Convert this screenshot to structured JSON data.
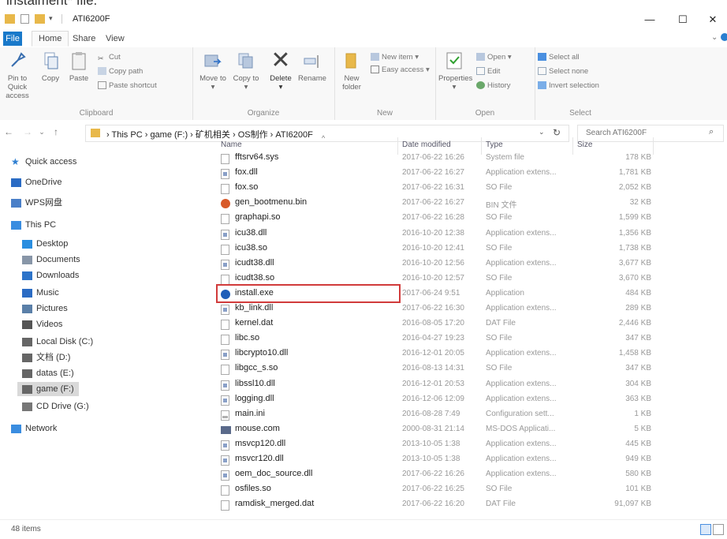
{
  "caption": "instalment* file.",
  "window": {
    "title": "ATI6200F",
    "minimize": "—",
    "maximize": "☐",
    "close": "✕"
  },
  "tabs": [
    "File",
    "Home",
    "Share",
    "View"
  ],
  "ribbon": {
    "clipboard": {
      "label": "Clipboard",
      "pin": "Pin to Quick access",
      "copy": "Copy",
      "paste": "Paste",
      "cut": "Cut",
      "copy_path": "Copy path",
      "paste_shortcut": "Paste shortcut"
    },
    "organize": {
      "label": "Organize",
      "move_to": "Move to",
      "copy_to": "Copy to",
      "delete": "Delete",
      "rename": "Rename"
    },
    "new": {
      "label": "New",
      "new_folder": "New folder",
      "new_item": "New item",
      "easy_access": "Easy access"
    },
    "open": {
      "label": "Open",
      "properties": "Properties",
      "open": "Open",
      "edit": "Edit",
      "history": "History"
    },
    "select": {
      "label": "Select",
      "select_all": "Select all",
      "select_none": "Select none",
      "invert": "Invert selection"
    }
  },
  "address": {
    "crumbs": [
      "This PC",
      "game (F:)",
      "矿机相关",
      "OS制作",
      "ATI6200F"
    ],
    "search_placeholder": "Search ATI6200F"
  },
  "nav": [
    {
      "label": "Quick access",
      "icon": "star-icon",
      "color": "#2f7fd1"
    },
    {
      "label": "OneDrive",
      "icon": "cloud-icon",
      "color": "#2b6cc4"
    },
    {
      "label": "WPS网盘",
      "icon": "cloud-outline-icon",
      "color": "#4a7fc8"
    },
    {
      "label": "This PC",
      "icon": "computer-icon",
      "color": "#3a8de0"
    },
    {
      "label": "Desktop",
      "icon": "desktop-icon",
      "color": "#2a8ee0"
    },
    {
      "label": "Documents",
      "icon": "documents-icon",
      "color": "#8896a8"
    },
    {
      "label": "Downloads",
      "icon": "download-icon",
      "color": "#2d74c9"
    },
    {
      "label": "Music",
      "icon": "music-icon",
      "color": "#2b6cc4"
    },
    {
      "label": "Pictures",
      "icon": "pictures-icon",
      "color": "#5a7fa8"
    },
    {
      "label": "Videos",
      "icon": "video-icon",
      "color": "#555"
    },
    {
      "label": "Local Disk (C:)",
      "icon": "drive-icon",
      "color": "#666"
    },
    {
      "label": "文档 (D:)",
      "icon": "drive-icon",
      "color": "#666"
    },
    {
      "label": "datas (E:)",
      "icon": "drive-icon",
      "color": "#666"
    },
    {
      "label": "game (F:)",
      "icon": "drive-icon",
      "color": "#666"
    },
    {
      "label": "CD Drive (G:)",
      "icon": "cd-drive-icon",
      "color": "#777"
    },
    {
      "label": "Network",
      "icon": "network-icon",
      "color": "#3a8de0"
    }
  ],
  "columns": {
    "name": "Name",
    "date": "Date modified",
    "type": "Type",
    "size": "Size"
  },
  "files": [
    {
      "name": "fftsrv64.sys",
      "date": "2017-06-22 16:26",
      "type": "System file",
      "size": "178 KB",
      "kind": "file"
    },
    {
      "name": "fox.dll",
      "date": "2017-06-22 16:27",
      "type": "Application extens...",
      "size": "1,781 KB",
      "kind": "dll"
    },
    {
      "name": "fox.so",
      "date": "2017-06-22 16:31",
      "type": "SO File",
      "size": "2,052 KB",
      "kind": "file"
    },
    {
      "name": "gen_bootmenu.bin",
      "date": "2017-06-22 16:27",
      "type": "BIN 文件",
      "size": "32 KB",
      "kind": "bin"
    },
    {
      "name": "graphapi.so",
      "date": "2017-06-22 16:28",
      "type": "SO File",
      "size": "1,599 KB",
      "kind": "file"
    },
    {
      "name": "icu38.dll",
      "date": "2016-10-20 12:38",
      "type": "Application extens...",
      "size": "1,356 KB",
      "kind": "dll"
    },
    {
      "name": "icu38.so",
      "date": "2016-10-20 12:41",
      "type": "SO File",
      "size": "1,738 KB",
      "kind": "file"
    },
    {
      "name": "icudt38.dll",
      "date": "2016-10-20 12:56",
      "type": "Application extens...",
      "size": "3,677 KB",
      "kind": "dll"
    },
    {
      "name": "icudt38.so",
      "date": "2016-10-20 12:57",
      "type": "SO File",
      "size": "3,670 KB",
      "kind": "file"
    },
    {
      "name": "install.exe",
      "date": "2017-06-24 9:51",
      "type": "Application",
      "size": "484 KB",
      "kind": "app"
    },
    {
      "name": "kb_link.dll",
      "date": "2017-06-22 16:30",
      "type": "Application extens...",
      "size": "289 KB",
      "kind": "dll"
    },
    {
      "name": "kernel.dat",
      "date": "2016-08-05 17:20",
      "type": "DAT File",
      "size": "2,446 KB",
      "kind": "file"
    },
    {
      "name": "libc.so",
      "date": "2016-04-27 19:23",
      "type": "SO File",
      "size": "347 KB",
      "kind": "file"
    },
    {
      "name": "libcrypto10.dll",
      "date": "2016-12-01 20:05",
      "type": "Application extens...",
      "size": "1,458 KB",
      "kind": "dll"
    },
    {
      "name": "libgcc_s.so",
      "date": "2016-08-13 14:31",
      "type": "SO File",
      "size": "347 KB",
      "kind": "file"
    },
    {
      "name": "libssl10.dll",
      "date": "2016-12-01 20:53",
      "type": "Application extens...",
      "size": "304 KB",
      "kind": "dll"
    },
    {
      "name": "logging.dll",
      "date": "2016-12-06 12:09",
      "type": "Application extens...",
      "size": "363 KB",
      "kind": "dll"
    },
    {
      "name": "main.ini",
      "date": "2016-08-28 7:49",
      "type": "Configuration sett...",
      "size": "1 KB",
      "kind": "ini"
    },
    {
      "name": "mouse.com",
      "date": "2000-08-31 21:14",
      "type": "MS-DOS Applicati...",
      "size": "5 KB",
      "kind": "com"
    },
    {
      "name": "msvcp120.dll",
      "date": "2013-10-05 1:38",
      "type": "Application extens...",
      "size": "445 KB",
      "kind": "dll"
    },
    {
      "name": "msvcr120.dll",
      "date": "2013-10-05 1:38",
      "type": "Application extens...",
      "size": "949 KB",
      "kind": "dll"
    },
    {
      "name": "oem_doc_source.dll",
      "date": "2017-06-22 16:26",
      "type": "Application extens...",
      "size": "580 KB",
      "kind": "dll"
    },
    {
      "name": "osfiles.so",
      "date": "2017-06-22 16:25",
      "type": "SO File",
      "size": "101 KB",
      "kind": "file"
    },
    {
      "name": "ramdisk_merged.dat",
      "date": "2017-06-22 16:20",
      "type": "DAT File",
      "size": "91,097 KB",
      "kind": "file"
    }
  ],
  "status": {
    "count": "48 items"
  }
}
